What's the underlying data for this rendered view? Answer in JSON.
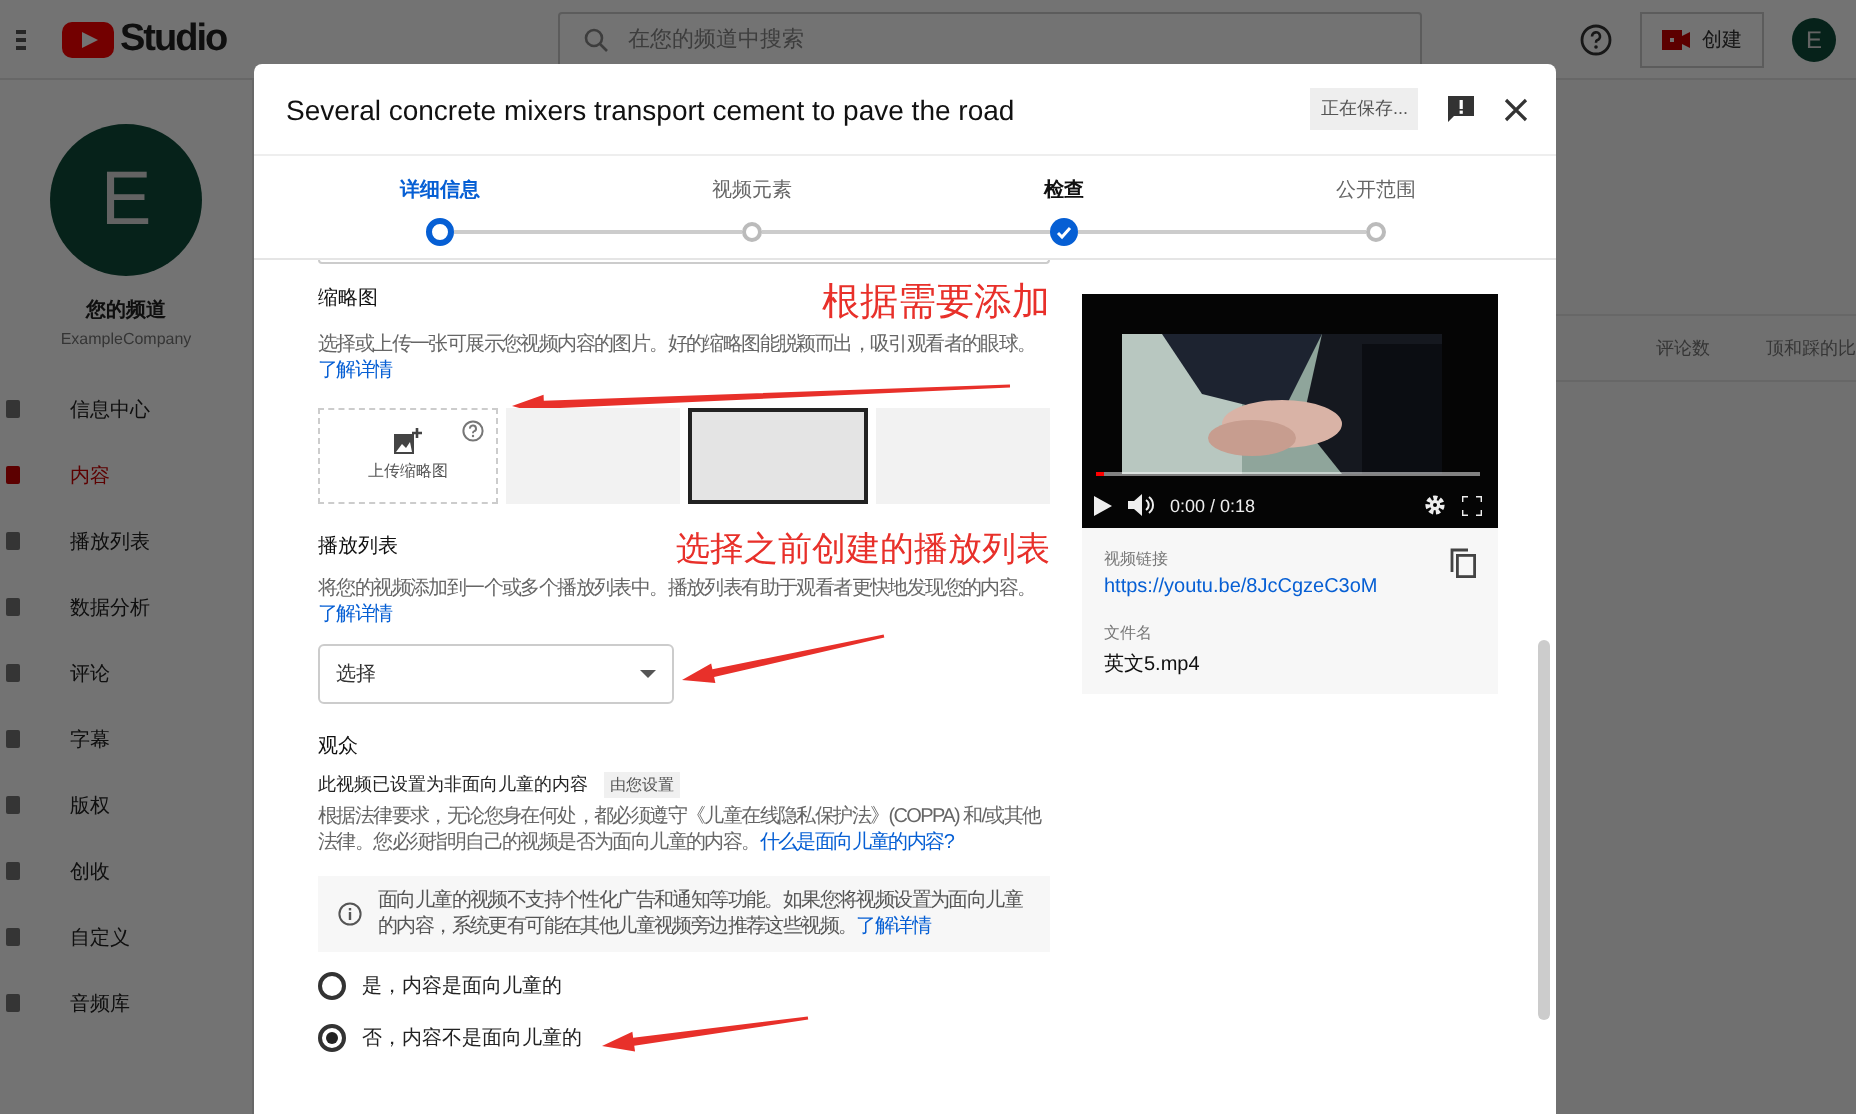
{
  "app": {
    "logo": "Studio",
    "search_placeholder": "在您的频道中搜索",
    "create_button": "创建",
    "avatar_letter": "E"
  },
  "sidebar": {
    "avatar_letter": "E",
    "channel_title": "您的频道",
    "channel_name": "ExampleCompany",
    "items": [
      {
        "label": "信息中心",
        "selected": false
      },
      {
        "label": "内容",
        "selected": true
      },
      {
        "label": "播放列表",
        "selected": false
      },
      {
        "label": "数据分析",
        "selected": false
      },
      {
        "label": "评论",
        "selected": false
      },
      {
        "label": "字幕",
        "selected": false
      },
      {
        "label": "版权",
        "selected": false
      },
      {
        "label": "创收",
        "selected": false
      },
      {
        "label": "自定义",
        "selected": false
      },
      {
        "label": "音频库",
        "selected": false
      }
    ]
  },
  "table": {
    "columns": [
      "评论数",
      "顶和踩的比"
    ]
  },
  "dialog": {
    "title": "Several concrete mixers transport cement to pave the road",
    "status": "正在保存...",
    "steps": [
      {
        "label": "详细信息",
        "selected": true,
        "done": false
      },
      {
        "label": "视频元素",
        "selected": false,
        "done": false
      },
      {
        "label": "检查",
        "selected": false,
        "done": true
      },
      {
        "label": "公开范围",
        "selected": false,
        "done": false
      }
    ],
    "thumbnails": {
      "heading": "缩略图",
      "description": "选择或上传一张可展示您视频内容的图片。好的缩略图能脱颖而出，吸引观看者的眼球。",
      "link": "了解详情",
      "upload_label": "上传缩略图",
      "options": [
        {
          "selected": false
        },
        {
          "selected": true
        },
        {
          "selected": false
        }
      ]
    },
    "playlist": {
      "heading": "播放列表",
      "description": "将您的视频添加到一个或多个播放列表中。播放列表有助于观看者更快地发现您的内容。",
      "link": "了解详情",
      "value": "选择"
    },
    "audience": {
      "heading": "观众",
      "status": "此视频已设置为非面向儿童的内容",
      "status_badge": "由您设置",
      "description": "根据法律要求，无论您身在何处，都必须遵守《儿童在线隐私保护法》(COPPA) 和/或其他法律。您必须指明自己的视频是否为面向儿童的内容。",
      "link": "什么是面向儿童的内容?",
      "notice": "面向儿童的视频不支持个性化广告和通知等功能。如果您将视频设置为面向儿童的内容，系统更有可能在其他儿童视频旁边推荐这些视频。",
      "notice_link": "了解详情",
      "options": [
        {
          "label": "是，内容是面向儿童的",
          "selected": false
        },
        {
          "label": "否，内容不是面向儿童的",
          "selected": true
        }
      ]
    },
    "preview": {
      "progress": {
        "level": 0.02
      },
      "time": "0:00 / 0:18",
      "link_label": "视频链接",
      "link": "https://youtu.be/8JcCgzeC3oM",
      "file_label": "文件名",
      "file_name": "英文5.mp4"
    }
  },
  "annotations": [
    "根据需要添加",
    "选择之前创建的播放列表"
  ]
}
